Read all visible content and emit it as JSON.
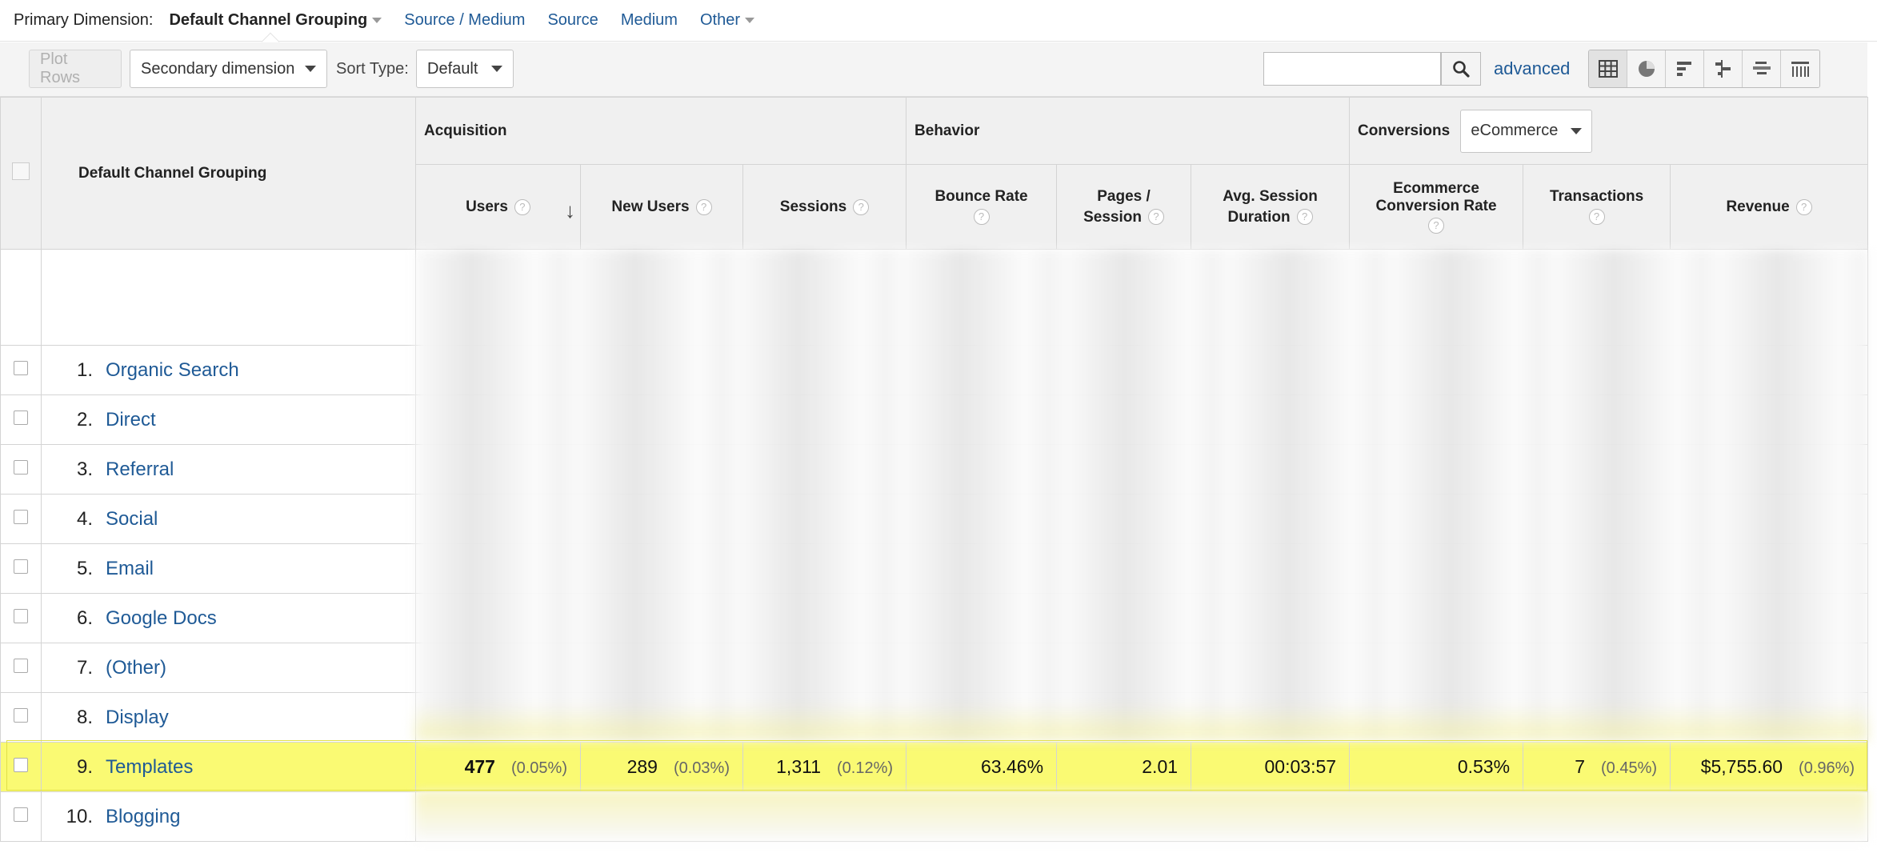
{
  "primary_dimension": {
    "label": "Primary Dimension:",
    "active": "Default Channel Grouping",
    "links": [
      "Source / Medium",
      "Source",
      "Medium",
      "Other"
    ]
  },
  "toolbar": {
    "plot_rows": "Plot Rows",
    "secondary_dimension": "Secondary dimension",
    "sort_type_label": "Sort Type:",
    "sort_type_value": "Default",
    "search_value": "",
    "advanced": "advanced",
    "view_icons": [
      "table-view-icon",
      "pie-view-icon",
      "performance-view-icon",
      "comparison-view-icon",
      "term-cloud-view-icon",
      "pivot-view-icon"
    ]
  },
  "table": {
    "dimension_header": "Default Channel Grouping",
    "groups": {
      "acquisition": "Acquisition",
      "behavior": "Behavior",
      "conversions": "Conversions",
      "conversions_select": "eCommerce"
    },
    "columns": {
      "users": "Users",
      "new_users": "New Users",
      "sessions": "Sessions",
      "bounce_rate": "Bounce Rate",
      "pages_session_1": "Pages /",
      "pages_session_2": "Session",
      "avg_session_1": "Avg. Session",
      "avg_session_2": "Duration",
      "ecommerce_1": "Ecommerce",
      "ecommerce_2": "Conversion Rate",
      "transactions": "Transactions",
      "revenue": "Revenue"
    },
    "help_glyph": "?",
    "rows": [
      {
        "num": "1.",
        "name": "Organic Search"
      },
      {
        "num": "2.",
        "name": "Direct"
      },
      {
        "num": "3.",
        "name": "Referral"
      },
      {
        "num": "4.",
        "name": "Social"
      },
      {
        "num": "5.",
        "name": "Email"
      },
      {
        "num": "6.",
        "name": "Google Docs"
      },
      {
        "num": "7.",
        "name": "(Other)"
      },
      {
        "num": "8.",
        "name": "Display"
      },
      {
        "num": "9.",
        "name": "Templates"
      },
      {
        "num": "10.",
        "name": "Blogging"
      }
    ],
    "highlight_row": {
      "users": "477",
      "users_pct": "(0.05%)",
      "new_users": "289",
      "new_users_pct": "(0.03%)",
      "sessions": "1,311",
      "sessions_pct": "(0.12%)",
      "bounce_rate": "63.46%",
      "pages_session": "2.01",
      "avg_duration": "00:03:57",
      "conversion_rate": "0.53%",
      "transactions": "7",
      "transactions_pct": "(0.45%)",
      "revenue": "$5,755.60",
      "revenue_pct": "(0.96%)"
    }
  },
  "colors": {
    "link": "#1f5a96",
    "highlight": "#fafa73",
    "header_bg": "#f0f0f0"
  }
}
